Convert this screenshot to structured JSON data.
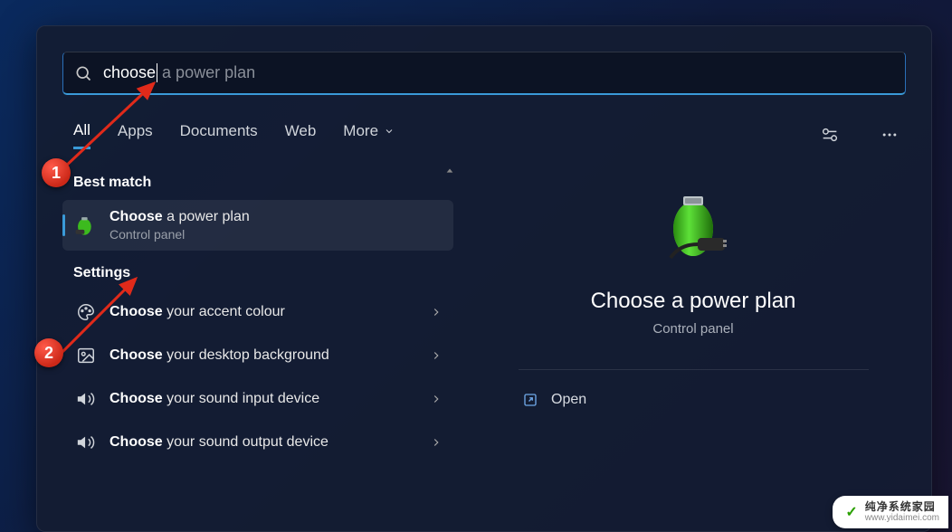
{
  "search": {
    "typed": "choose",
    "suggestion": " a power plan"
  },
  "tabs": {
    "items": [
      "All",
      "Apps",
      "Documents",
      "Web",
      "More"
    ],
    "active_index": 0
  },
  "sections": {
    "best_match_label": "Best match",
    "settings_label": "Settings"
  },
  "best_match": {
    "title_bold": "Choose",
    "title_rest": " a power plan",
    "subtitle": "Control panel"
  },
  "settings_items": [
    {
      "bold": "Choose",
      "rest": " your accent colour",
      "icon": "palette"
    },
    {
      "bold": "Choose",
      "rest": " your desktop background",
      "icon": "image"
    },
    {
      "bold": "Choose",
      "rest": " your sound input device",
      "icon": "volume"
    },
    {
      "bold": "Choose",
      "rest": " your sound output device",
      "icon": "volume"
    }
  ],
  "detail": {
    "title": "Choose a power plan",
    "subtitle": "Control panel",
    "action_open": "Open"
  },
  "annotations": {
    "one": "1",
    "two": "2"
  },
  "watermark": {
    "name": "纯净系统家园",
    "url": "www.yidaimei.com"
  }
}
